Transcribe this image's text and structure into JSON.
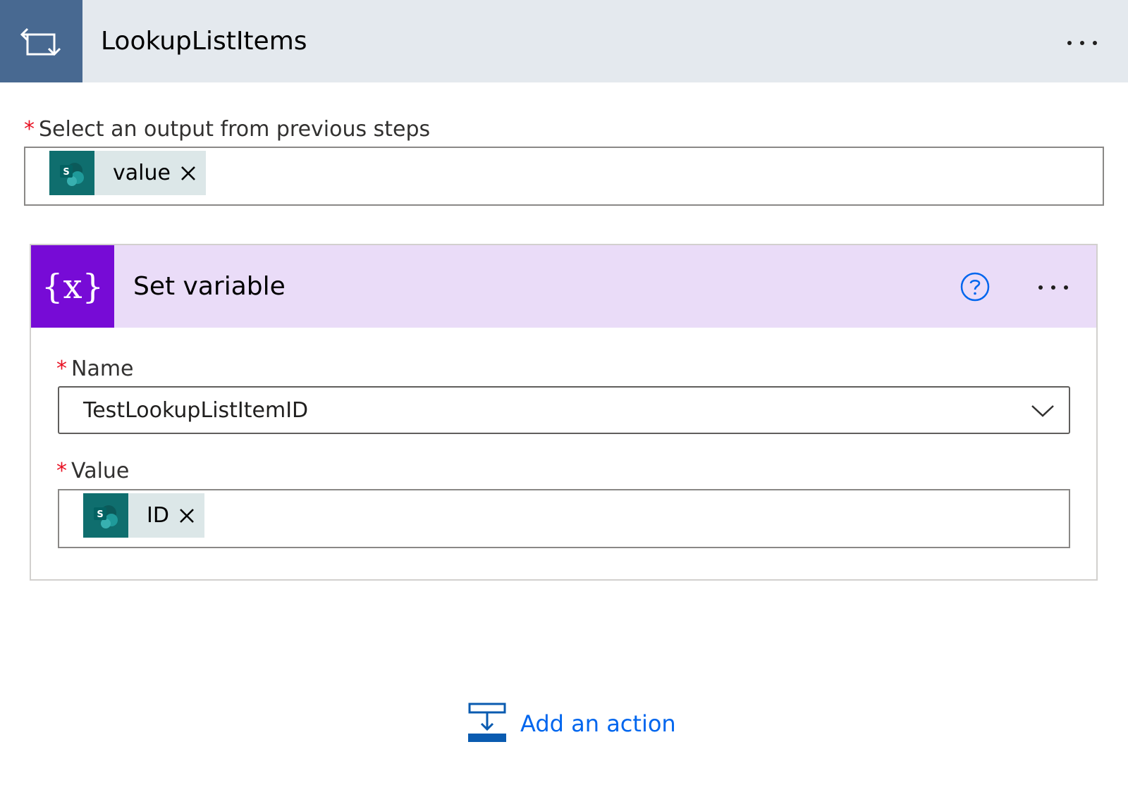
{
  "loop": {
    "title": "LookupListItems",
    "icon": "loop-icon",
    "more_icon": "more-options-icon"
  },
  "output_field": {
    "label": "Select an output from previous steps",
    "required_mark": "*",
    "token": {
      "text": "value",
      "icon": "sharepoint-icon",
      "remove_glyph": "×"
    }
  },
  "set_variable": {
    "title": "Set variable",
    "icon_text": "{x}",
    "help_icon": "help-icon",
    "more_icon": "more-options-icon",
    "name_field": {
      "label": "Name",
      "required_mark": "*",
      "value": "TestLookupListItemID"
    },
    "value_field": {
      "label": "Value",
      "required_mark": "*",
      "token": {
        "text": "ID",
        "icon": "sharepoint-icon",
        "remove_glyph": "×"
      }
    }
  },
  "add_action": {
    "label": "Add an action",
    "icon": "add-action-icon"
  },
  "colors": {
    "loop_accent": "#486991",
    "loop_header_bg": "#e4e9ee",
    "variable_accent": "#770bd6",
    "variable_header_bg": "#eadcf8",
    "sharepoint": "#0f6e6e",
    "token_bg": "#dce7e8",
    "link": "#0066ee",
    "required": "#e81123"
  }
}
